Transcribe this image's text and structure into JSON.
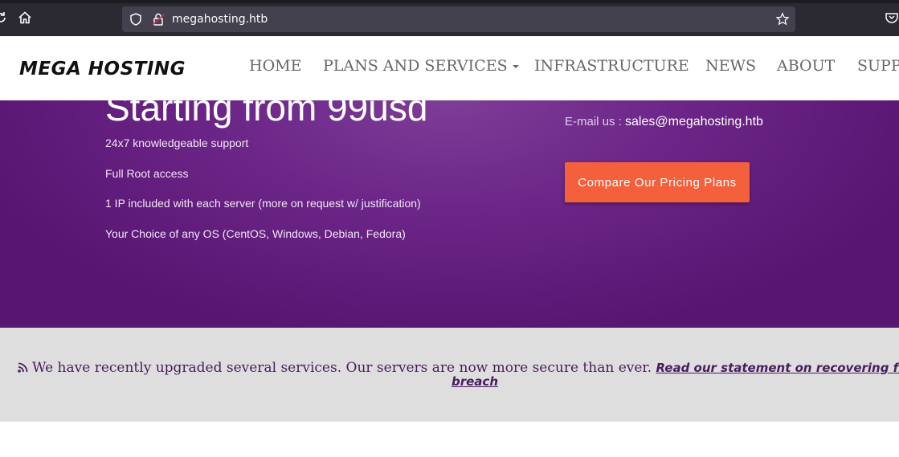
{
  "browser": {
    "url": "megahosting.htb",
    "icons": [
      "reload-icon",
      "home-icon",
      "shield-icon",
      "lock-icon",
      "star-icon",
      "pocket-icon"
    ]
  },
  "site": {
    "logo": "MEGA HOSTING",
    "nav": [
      {
        "label": "HOME"
      },
      {
        "label": "PLANS AND SERVICES"
      },
      {
        "label": "INFRASTRUCTURE"
      },
      {
        "label": "NEWS"
      },
      {
        "label": "ABOUT"
      },
      {
        "label": "SUPP"
      }
    ]
  },
  "hero": {
    "title": "Starting from 99usd",
    "features": [
      "24x7 knowledgeable support",
      "Full Root access",
      "1 IP included with each server (more on request w/ justification)",
      "Your Choice of any OS (CentOS, Windows, Debian, Fedora)"
    ],
    "email_label": "E-mail us : ",
    "email": "sales@megahosting.htb",
    "cta": "Compare Our Pricing Plans"
  },
  "announcement": {
    "text": "We have recently upgraded several services. Our servers are now more secure than ever.",
    "link_line1": "Read our statement on recovering from the",
    "link_line2": "breach"
  },
  "colors": {
    "hero_purple": "#6c2688",
    "cta_orange": "#f5603c",
    "announce_text": "#4a1c5f"
  }
}
